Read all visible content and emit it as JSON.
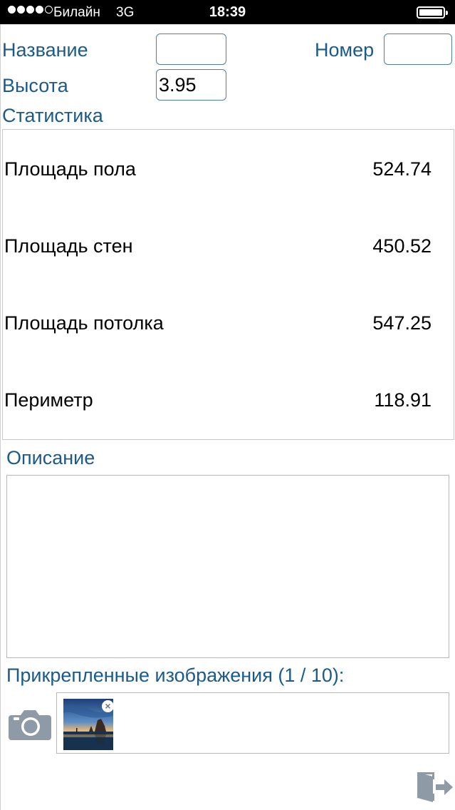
{
  "status_bar": {
    "carrier": "Билайн",
    "network": "3G",
    "time": "18:39",
    "signal_bars": 4,
    "battery_level": 1.0
  },
  "form": {
    "name_label": "Название",
    "name_value": "",
    "number_label": "Номер",
    "number_value": "",
    "height_label": "Высота",
    "height_value": "3.95"
  },
  "statistics": {
    "title": "Статистика",
    "rows": [
      {
        "name": "Площадь пола",
        "value": "524.74"
      },
      {
        "name": "Площадь стен",
        "value": "450.52"
      },
      {
        "name": "Площадь потолка",
        "value": "547.25"
      },
      {
        "name": "Периметр",
        "value": "118.91"
      }
    ]
  },
  "description": {
    "title": "Описание",
    "value": ""
  },
  "attachments": {
    "title": "Прикрепленные изображения (1 / 10):",
    "remove_symbol": "×"
  },
  "icons": {
    "camera": "camera-icon",
    "exit": "exit-door-icon",
    "remove": "close-icon"
  },
  "colors": {
    "label": "#1c5a8a",
    "field_border": "#4e7fa3",
    "icon_gray": "#8e9aa6"
  }
}
